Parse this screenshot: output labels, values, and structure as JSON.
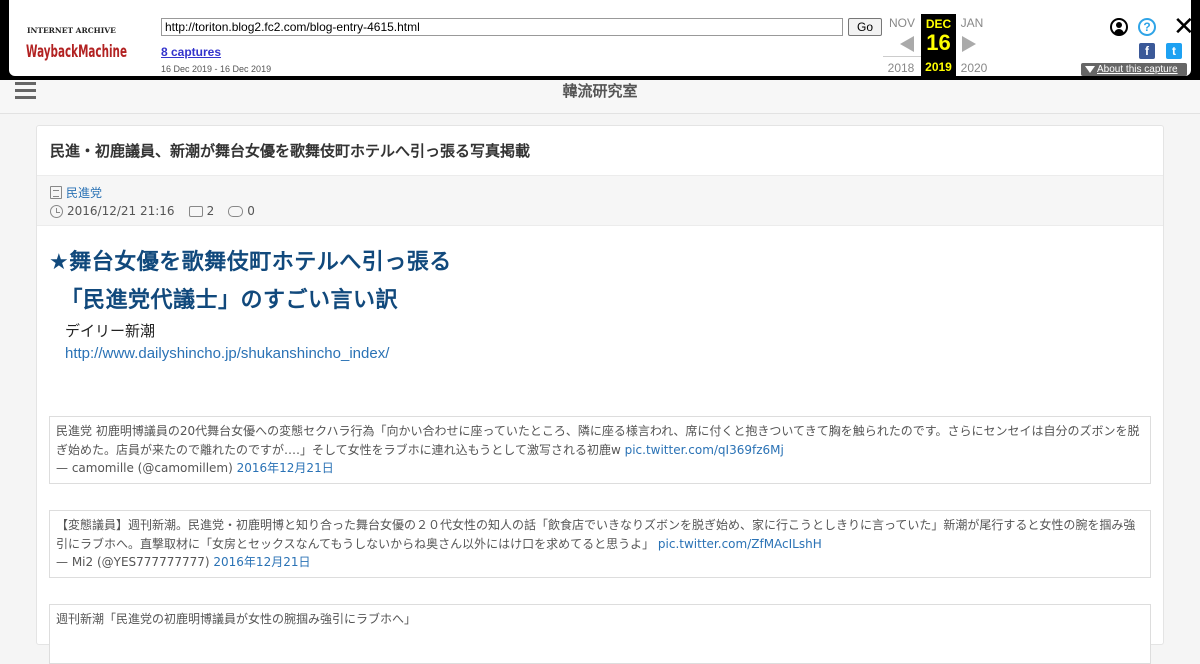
{
  "wayback": {
    "logo_top": "INTERNET ARCHIVE",
    "logo_main": "WaybackMachine",
    "url": "http://toriton.blog2.fc2.com/blog-entry-4615.html",
    "go_label": "Go",
    "captures": "8 captures",
    "range": "16 Dec 2019 - 16 Dec 2019",
    "prev_month": "NOV",
    "current_month": "DEC",
    "next_month": "JAN",
    "current_day": "16",
    "prev_year": "2018",
    "current_year": "2019",
    "next_year": "2020",
    "about": "About this capture",
    "help_glyph": "?",
    "close_glyph": "✕",
    "fb_glyph": "f",
    "tw_glyph": "t"
  },
  "site": {
    "title": "韓流研究室"
  },
  "article": {
    "title": "民進・初鹿議員、新潮が舞台女優を歌舞伎町ホテルへ引っ張る写真掲載",
    "category": "民進党",
    "date": "2016/12/21 21:16",
    "comments": "2",
    "trackbacks": "0",
    "headline1": "★舞台女優を歌舞伎町ホテルへ引っ張る",
    "headline2": "　「民進党代議士」のすごい言い訳",
    "source_name": "デイリー新潮",
    "source_link": "http://www.dailyshincho.jp/shukanshincho_index/"
  },
  "tweets": [
    {
      "text": "民進党 初鹿明博議員の20代舞台女優への変態セクハラ行為「向かい合わせに座っていたところ、隣に座る様言われ、席に付くと抱きついてきて胸を触られたのです。さらにセンセイは自分のズボンを脱ぎ始めた。店員が来たので離れたのですが‥‥」そして女性をラブホに連れ込もうとして激写される初鹿w",
      "pic": "pic.twitter.com/qI369fz6Mj",
      "author": "— camomille (@camomillem)",
      "date": "2016年12月21日"
    },
    {
      "text": "【変態議員】週刊新潮。民進党・初鹿明博と知り合った舞台女優の２０代女性の知人の話「飲食店でいきなりズボンを脱ぎ始め、家に行こうとしきりに言っていた」新潮が尾行すると女性の腕を掴み強引にラブホへ。直撃取材に「女房とセックスなんてもうしないからね奥さん以外にはけ口を求めてると思うよ」",
      "pic": "pic.twitter.com/ZfMAcILshH",
      "author": "— Mi2 (@YES777777777)",
      "date": "2016年12月21日"
    },
    {
      "text": "週刊新潮「民進党の初鹿明博議員が女性の腕掴み強引にラブホへ」"
    }
  ]
}
